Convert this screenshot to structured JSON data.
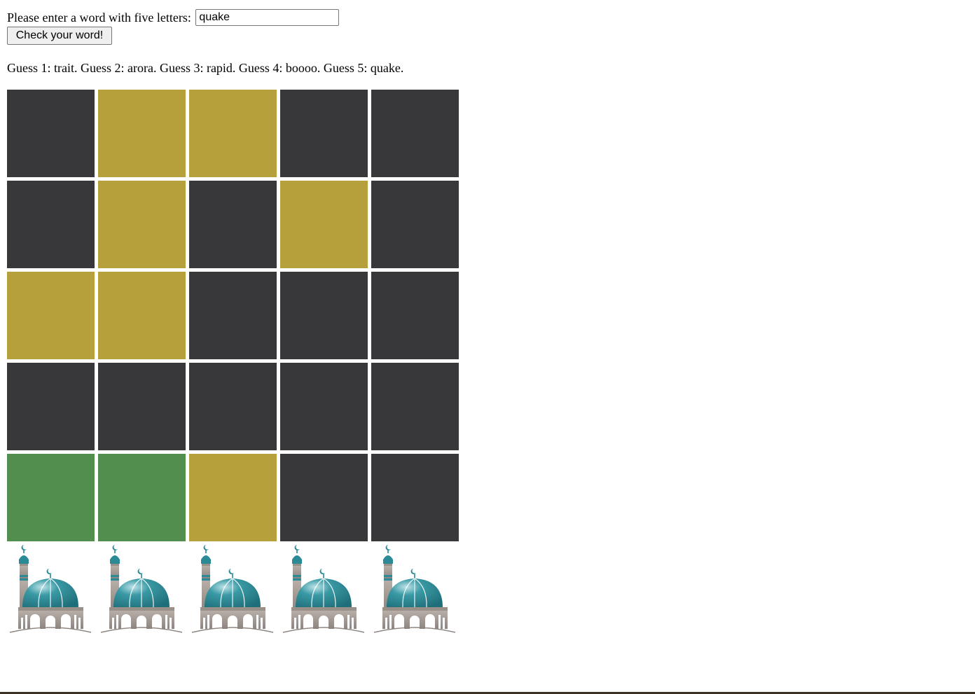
{
  "form": {
    "prompt": "Please enter a word with five letters:",
    "input_value": "quake",
    "button_label": "Check your word!"
  },
  "guesses_text": "Guess 1: trait. Guess 2: arora. Guess 3: rapid. Guess 4: boooo. Guess 5: quake.",
  "colors": {
    "absent": "#38383b",
    "present": "#b5a03c",
    "correct": "#528e4e"
  },
  "grid": [
    [
      "absent",
      "present",
      "present",
      "absent",
      "absent"
    ],
    [
      "absent",
      "present",
      "absent",
      "present",
      "absent"
    ],
    [
      "present",
      "present",
      "absent",
      "absent",
      "absent"
    ],
    [
      "absent",
      "absent",
      "absent",
      "absent",
      "absent"
    ],
    [
      "correct",
      "correct",
      "present",
      "absent",
      "absent"
    ]
  ],
  "icons": [
    "mosque-icon",
    "mosque-icon",
    "mosque-icon",
    "mosque-icon",
    "mosque-icon"
  ]
}
